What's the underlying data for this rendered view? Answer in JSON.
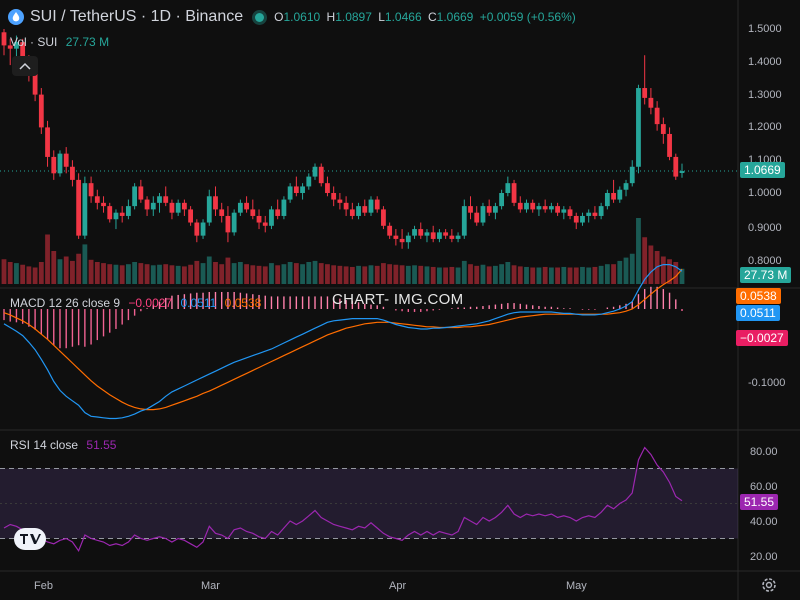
{
  "header": {
    "symbol": "SUI / TetherUS · 1D · Binance",
    "open_label": "O",
    "open": "1.0610",
    "high_label": "H",
    "high": "1.0897",
    "low_label": "L",
    "low": "1.0466",
    "close_label": "C",
    "close": "1.0669",
    "change": "+0.0059 (+0.56%)"
  },
  "volume_legend": {
    "label": "Vol · SUI",
    "value": "27.73 M",
    "tag": "27.73 M"
  },
  "macd_legend": {
    "label": "MACD 12 26 close 9",
    "histogram": "−0.0027",
    "macd": "0.0511",
    "signal": "0.0538"
  },
  "rsi_legend": {
    "label": "RSI 14 close",
    "value": "51.55"
  },
  "watermark": "CHART- IMG.COM",
  "price_tag": "1.0669",
  "colors": {
    "up": "#26a69a",
    "down": "#f23645",
    "macd_line": "#2962ff",
    "signal_line": "#ff6d00",
    "histogram": "#ff4081",
    "rsi": "#9c27b0",
    "background": "#0f0f0f"
  },
  "icons": [
    "sui-logo-icon",
    "live-dot-icon",
    "collapse-chevron-icon",
    "tradingview-logo-icon",
    "settings-gear-icon"
  ],
  "chart_data": [
    {
      "type": "candlestick",
      "title": "SUI / TetherUS · 1D · Binance",
      "x_ticks": [
        "Feb",
        "Mar",
        "Apr",
        "May"
      ],
      "y_ticks": [
        "0.8000",
        "0.9000",
        "1.0000",
        "1.1000",
        "1.2000",
        "1.3000",
        "1.4000",
        "1.5000"
      ],
      "ylim": [
        0.75,
        1.56
      ],
      "ohlc": [
        [
          1.49,
          1.5,
          1.42,
          1.45
        ],
        [
          1.45,
          1.47,
          1.39,
          1.44
        ],
        [
          1.44,
          1.48,
          1.4,
          1.46
        ],
        [
          1.46,
          1.47,
          1.38,
          1.4
        ],
        [
          1.4,
          1.42,
          1.34,
          1.37
        ],
        [
          1.37,
          1.39,
          1.28,
          1.3
        ],
        [
          1.3,
          1.32,
          1.18,
          1.2
        ],
        [
          1.2,
          1.22,
          1.08,
          1.11
        ],
        [
          1.11,
          1.13,
          1.04,
          1.06
        ],
        [
          1.06,
          1.13,
          1.05,
          1.12
        ],
        [
          1.12,
          1.14,
          1.06,
          1.08
        ],
        [
          1.08,
          1.1,
          1.02,
          1.04
        ],
        [
          1.04,
          1.06,
          0.86,
          0.87
        ],
        [
          0.87,
          1.05,
          0.86,
          1.03
        ],
        [
          1.03,
          1.05,
          0.97,
          0.99
        ],
        [
          0.99,
          1.01,
          0.95,
          0.97
        ],
        [
          0.97,
          0.99,
          0.94,
          0.96
        ],
        [
          0.96,
          0.97,
          0.91,
          0.92
        ],
        [
          0.92,
          0.95,
          0.89,
          0.94
        ],
        [
          0.94,
          0.96,
          0.91,
          0.93
        ],
        [
          0.93,
          0.98,
          0.92,
          0.96
        ],
        [
          0.96,
          1.03,
          0.95,
          1.02
        ],
        [
          1.02,
          1.04,
          0.97,
          0.98
        ],
        [
          0.98,
          0.99,
          0.93,
          0.95
        ],
        [
          0.95,
          0.99,
          0.93,
          0.97
        ],
        [
          0.97,
          1.0,
          0.94,
          0.99
        ],
        [
          0.99,
          1.02,
          0.96,
          0.97
        ],
        [
          0.97,
          0.98,
          0.92,
          0.94
        ],
        [
          0.94,
          0.98,
          0.93,
          0.97
        ],
        [
          0.97,
          0.98,
          0.93,
          0.95
        ],
        [
          0.95,
          0.96,
          0.9,
          0.91
        ],
        [
          0.91,
          0.92,
          0.85,
          0.87
        ],
        [
          0.87,
          0.92,
          0.86,
          0.91
        ],
        [
          0.91,
          1.01,
          0.9,
          0.99
        ],
        [
          0.99,
          1.02,
          0.93,
          0.95
        ],
        [
          0.95,
          0.97,
          0.91,
          0.93
        ],
        [
          0.93,
          0.96,
          0.85,
          0.88
        ],
        [
          0.88,
          0.95,
          0.87,
          0.94
        ],
        [
          0.94,
          0.98,
          0.93,
          0.97
        ],
        [
          0.97,
          0.99,
          0.94,
          0.95
        ],
        [
          0.95,
          0.98,
          0.92,
          0.93
        ],
        [
          0.93,
          0.95,
          0.89,
          0.91
        ],
        [
          0.91,
          0.93,
          0.88,
          0.9
        ],
        [
          0.9,
          0.96,
          0.89,
          0.95
        ],
        [
          0.95,
          0.98,
          0.92,
          0.93
        ],
        [
          0.93,
          0.99,
          0.92,
          0.98
        ],
        [
          0.98,
          1.03,
          0.97,
          1.02
        ],
        [
          1.02,
          1.05,
          0.99,
          1.0
        ],
        [
          1.0,
          1.03,
          0.98,
          1.02
        ],
        [
          1.02,
          1.06,
          1.01,
          1.05
        ],
        [
          1.05,
          1.09,
          1.04,
          1.08
        ],
        [
          1.08,
          1.09,
          1.02,
          1.03
        ],
        [
          1.03,
          1.05,
          0.99,
          1.0
        ],
        [
          1.0,
          1.02,
          0.96,
          0.98
        ],
        [
          0.98,
          1.0,
          0.95,
          0.97
        ],
        [
          0.97,
          0.99,
          0.93,
          0.95
        ],
        [
          0.95,
          0.97,
          0.92,
          0.93
        ],
        [
          0.93,
          0.97,
          0.92,
          0.96
        ],
        [
          0.96,
          0.98,
          0.93,
          0.94
        ],
        [
          0.94,
          0.99,
          0.93,
          0.98
        ],
        [
          0.98,
          0.99,
          0.94,
          0.95
        ],
        [
          0.95,
          0.96,
          0.89,
          0.9
        ],
        [
          0.9,
          0.91,
          0.86,
          0.87
        ],
        [
          0.87,
          0.89,
          0.84,
          0.86
        ],
        [
          0.86,
          0.89,
          0.83,
          0.85
        ],
        [
          0.85,
          0.88,
          0.83,
          0.87
        ],
        [
          0.87,
          0.9,
          0.86,
          0.89
        ],
        [
          0.89,
          0.91,
          0.86,
          0.87
        ],
        [
          0.87,
          0.89,
          0.85,
          0.88
        ],
        [
          0.88,
          0.9,
          0.85,
          0.86
        ],
        [
          0.86,
          0.89,
          0.85,
          0.88
        ],
        [
          0.88,
          0.89,
          0.86,
          0.87
        ],
        [
          0.87,
          0.89,
          0.85,
          0.86
        ],
        [
          0.86,
          0.88,
          0.85,
          0.87
        ],
        [
          0.87,
          0.98,
          0.86,
          0.96
        ],
        [
          0.96,
          0.99,
          0.92,
          0.94
        ],
        [
          0.94,
          0.96,
          0.9,
          0.91
        ],
        [
          0.91,
          0.97,
          0.9,
          0.96
        ],
        [
          0.96,
          0.98,
          0.93,
          0.94
        ],
        [
          0.94,
          0.97,
          0.92,
          0.96
        ],
        [
          0.96,
          1.01,
          0.95,
          1.0
        ],
        [
          1.0,
          1.05,
          0.99,
          1.03
        ],
        [
          1.03,
          1.04,
          0.96,
          0.97
        ],
        [
          0.97,
          0.99,
          0.94,
          0.95
        ],
        [
          0.95,
          0.98,
          0.94,
          0.97
        ],
        [
          0.97,
          0.98,
          0.94,
          0.95
        ],
        [
          0.95,
          0.97,
          0.93,
          0.96
        ],
        [
          0.96,
          0.98,
          0.94,
          0.95
        ],
        [
          0.95,
          0.97,
          0.94,
          0.96
        ],
        [
          0.96,
          0.97,
          0.93,
          0.94
        ],
        [
          0.94,
          0.96,
          0.92,
          0.95
        ],
        [
          0.95,
          0.96,
          0.92,
          0.93
        ],
        [
          0.93,
          0.94,
          0.89,
          0.91
        ],
        [
          0.91,
          0.94,
          0.9,
          0.93
        ],
        [
          0.93,
          0.95,
          0.91,
          0.94
        ],
        [
          0.94,
          0.96,
          0.92,
          0.93
        ],
        [
          0.93,
          0.97,
          0.92,
          0.96
        ],
        [
          0.96,
          1.01,
          0.95,
          1.0
        ],
        [
          1.0,
          1.04,
          0.97,
          0.98
        ],
        [
          0.98,
          1.02,
          0.97,
          1.01
        ],
        [
          1.01,
          1.04,
          0.99,
          1.03
        ],
        [
          1.03,
          1.1,
          1.02,
          1.08
        ],
        [
          1.08,
          1.33,
          1.06,
          1.32
        ],
        [
          1.32,
          1.42,
          1.27,
          1.29
        ],
        [
          1.29,
          1.32,
          1.24,
          1.26
        ],
        [
          1.26,
          1.28,
          1.19,
          1.21
        ],
        [
          1.21,
          1.23,
          1.15,
          1.18
        ],
        [
          1.18,
          1.2,
          1.1,
          1.11
        ],
        [
          1.11,
          1.12,
          1.04,
          1.05
        ],
        [
          1.061,
          1.0897,
          1.0466,
          1.0669
        ]
      ]
    },
    {
      "type": "bar",
      "title": "Vol · SUI",
      "last_value_label": "27.73 M",
      "values_millions": [
        45,
        40,
        38,
        35,
        32,
        30,
        40,
        90,
        60,
        45,
        50,
        42,
        55,
        72,
        44,
        40,
        38,
        36,
        35,
        34,
        36,
        40,
        38,
        36,
        34,
        35,
        36,
        34,
        33,
        32,
        35,
        42,
        38,
        50,
        40,
        36,
        48,
        38,
        40,
        36,
        34,
        33,
        32,
        38,
        34,
        36,
        40,
        38,
        36,
        40,
        42,
        38,
        36,
        34,
        33,
        32,
        31,
        33,
        32,
        34,
        33,
        38,
        36,
        35,
        34,
        33,
        34,
        33,
        32,
        31,
        30,
        30,
        31,
        30,
        42,
        36,
        33,
        35,
        32,
        33,
        36,
        40,
        34,
        32,
        31,
        30,
        30,
        31,
        30,
        30,
        31,
        30,
        30,
        31,
        30,
        31,
        33,
        36,
        36,
        42,
        48,
        55,
        120,
        85,
        70,
        60,
        50,
        45,
        40,
        27.73
      ]
    },
    {
      "type": "line",
      "title": "MACD 12 26 close 9",
      "y_ticks": [
        "-0.1000"
      ],
      "ylim": [
        -0.165,
        0.075
      ],
      "macd_last": 0.0511,
      "signal_last": 0.0538,
      "histogram_last": -0.0027,
      "series": [
        {
          "name": "MACD",
          "values": [
            -0.02,
            -0.025,
            -0.03,
            -0.036,
            -0.045,
            -0.055,
            -0.068,
            -0.082,
            -0.098,
            -0.11,
            -0.118,
            -0.124,
            -0.13,
            -0.14,
            -0.145,
            -0.146,
            -0.147,
            -0.148,
            -0.148,
            -0.147,
            -0.145,
            -0.142,
            -0.138,
            -0.135,
            -0.13,
            -0.125,
            -0.118,
            -0.112,
            -0.108,
            -0.104,
            -0.1,
            -0.096,
            -0.092,
            -0.088,
            -0.084,
            -0.08,
            -0.076,
            -0.072,
            -0.069,
            -0.066,
            -0.063,
            -0.06,
            -0.057,
            -0.054,
            -0.05,
            -0.046,
            -0.042,
            -0.038,
            -0.034,
            -0.03,
            -0.026,
            -0.022,
            -0.018,
            -0.016,
            -0.015,
            -0.014,
            -0.013,
            -0.013,
            -0.013,
            -0.013,
            -0.013,
            -0.015,
            -0.018,
            -0.021,
            -0.023,
            -0.025,
            -0.026,
            -0.027,
            -0.027,
            -0.026,
            -0.026,
            -0.025,
            -0.024,
            -0.023,
            -0.022,
            -0.021,
            -0.02,
            -0.018,
            -0.016,
            -0.013,
            -0.01,
            -0.007,
            -0.005,
            -0.004,
            -0.004,
            -0.004,
            -0.004,
            -0.004,
            -0.004,
            -0.005,
            -0.006,
            -0.006,
            -0.007,
            -0.008,
            -0.008,
            -0.008,
            -0.007,
            -0.005,
            -0.003,
            0.0,
            0.004,
            0.01,
            0.026,
            0.04,
            0.05,
            0.057,
            0.06,
            0.06,
            0.057,
            0.0511
          ]
        },
        {
          "name": "Signal",
          "values": [
            -0.005,
            -0.008,
            -0.012,
            -0.016,
            -0.021,
            -0.027,
            -0.034,
            -0.041,
            -0.049,
            -0.057,
            -0.065,
            -0.073,
            -0.081,
            -0.089,
            -0.097,
            -0.104,
            -0.11,
            -0.116,
            -0.121,
            -0.126,
            -0.13,
            -0.133,
            -0.135,
            -0.136,
            -0.136,
            -0.135,
            -0.133,
            -0.13,
            -0.127,
            -0.124,
            -0.121,
            -0.118,
            -0.114,
            -0.111,
            -0.107,
            -0.103,
            -0.099,
            -0.095,
            -0.091,
            -0.087,
            -0.083,
            -0.079,
            -0.075,
            -0.071,
            -0.067,
            -0.063,
            -0.059,
            -0.055,
            -0.051,
            -0.047,
            -0.043,
            -0.039,
            -0.035,
            -0.032,
            -0.029,
            -0.026,
            -0.024,
            -0.022,
            -0.02,
            -0.019,
            -0.018,
            -0.018,
            -0.018,
            -0.019,
            -0.02,
            -0.021,
            -0.022,
            -0.023,
            -0.024,
            -0.024,
            -0.025,
            -0.025,
            -0.025,
            -0.025,
            -0.024,
            -0.024,
            -0.023,
            -0.022,
            -0.021,
            -0.019,
            -0.017,
            -0.015,
            -0.013,
            -0.011,
            -0.01,
            -0.009,
            -0.008,
            -0.007,
            -0.007,
            -0.007,
            -0.007,
            -0.007,
            -0.007,
            -0.007,
            -0.007,
            -0.007,
            -0.007,
            -0.007,
            -0.006,
            -0.005,
            -0.003,
            0.0,
            0.006,
            0.013,
            0.02,
            0.027,
            0.033,
            0.038,
            0.044,
            0.0538
          ]
        }
      ]
    },
    {
      "type": "line",
      "title": "RSI 14 close",
      "y_ticks": [
        "20.00",
        "40.00",
        "60.00",
        "80.00"
      ],
      "ylim": [
        14,
        89
      ],
      "bands": [
        70,
        30
      ],
      "last_value": 51.55,
      "series": [
        {
          "name": "RSI",
          "values": [
            36,
            38,
            37,
            35,
            33,
            31,
            30,
            28,
            27,
            29,
            30,
            28,
            23,
            32,
            30,
            29,
            28,
            26,
            27,
            26,
            28,
            32,
            30,
            29,
            30,
            31,
            30,
            28,
            30,
            29,
            27,
            25,
            28,
            37,
            33,
            32,
            30,
            35,
            36,
            34,
            33,
            31,
            30,
            34,
            32,
            36,
            40,
            38,
            40,
            43,
            46,
            42,
            40,
            38,
            37,
            36,
            35,
            37,
            36,
            39,
            36,
            33,
            31,
            30,
            29,
            32,
            34,
            32,
            34,
            32,
            34,
            33,
            32,
            34,
            42,
            40,
            38,
            42,
            40,
            42,
            45,
            49,
            44,
            42,
            44,
            43,
            44,
            43,
            44,
            42,
            43,
            42,
            40,
            42,
            43,
            42,
            45,
            49,
            47,
            50,
            52,
            56,
            75,
            82,
            78,
            72,
            68,
            62,
            54,
            51.55
          ]
        }
      ]
    }
  ]
}
